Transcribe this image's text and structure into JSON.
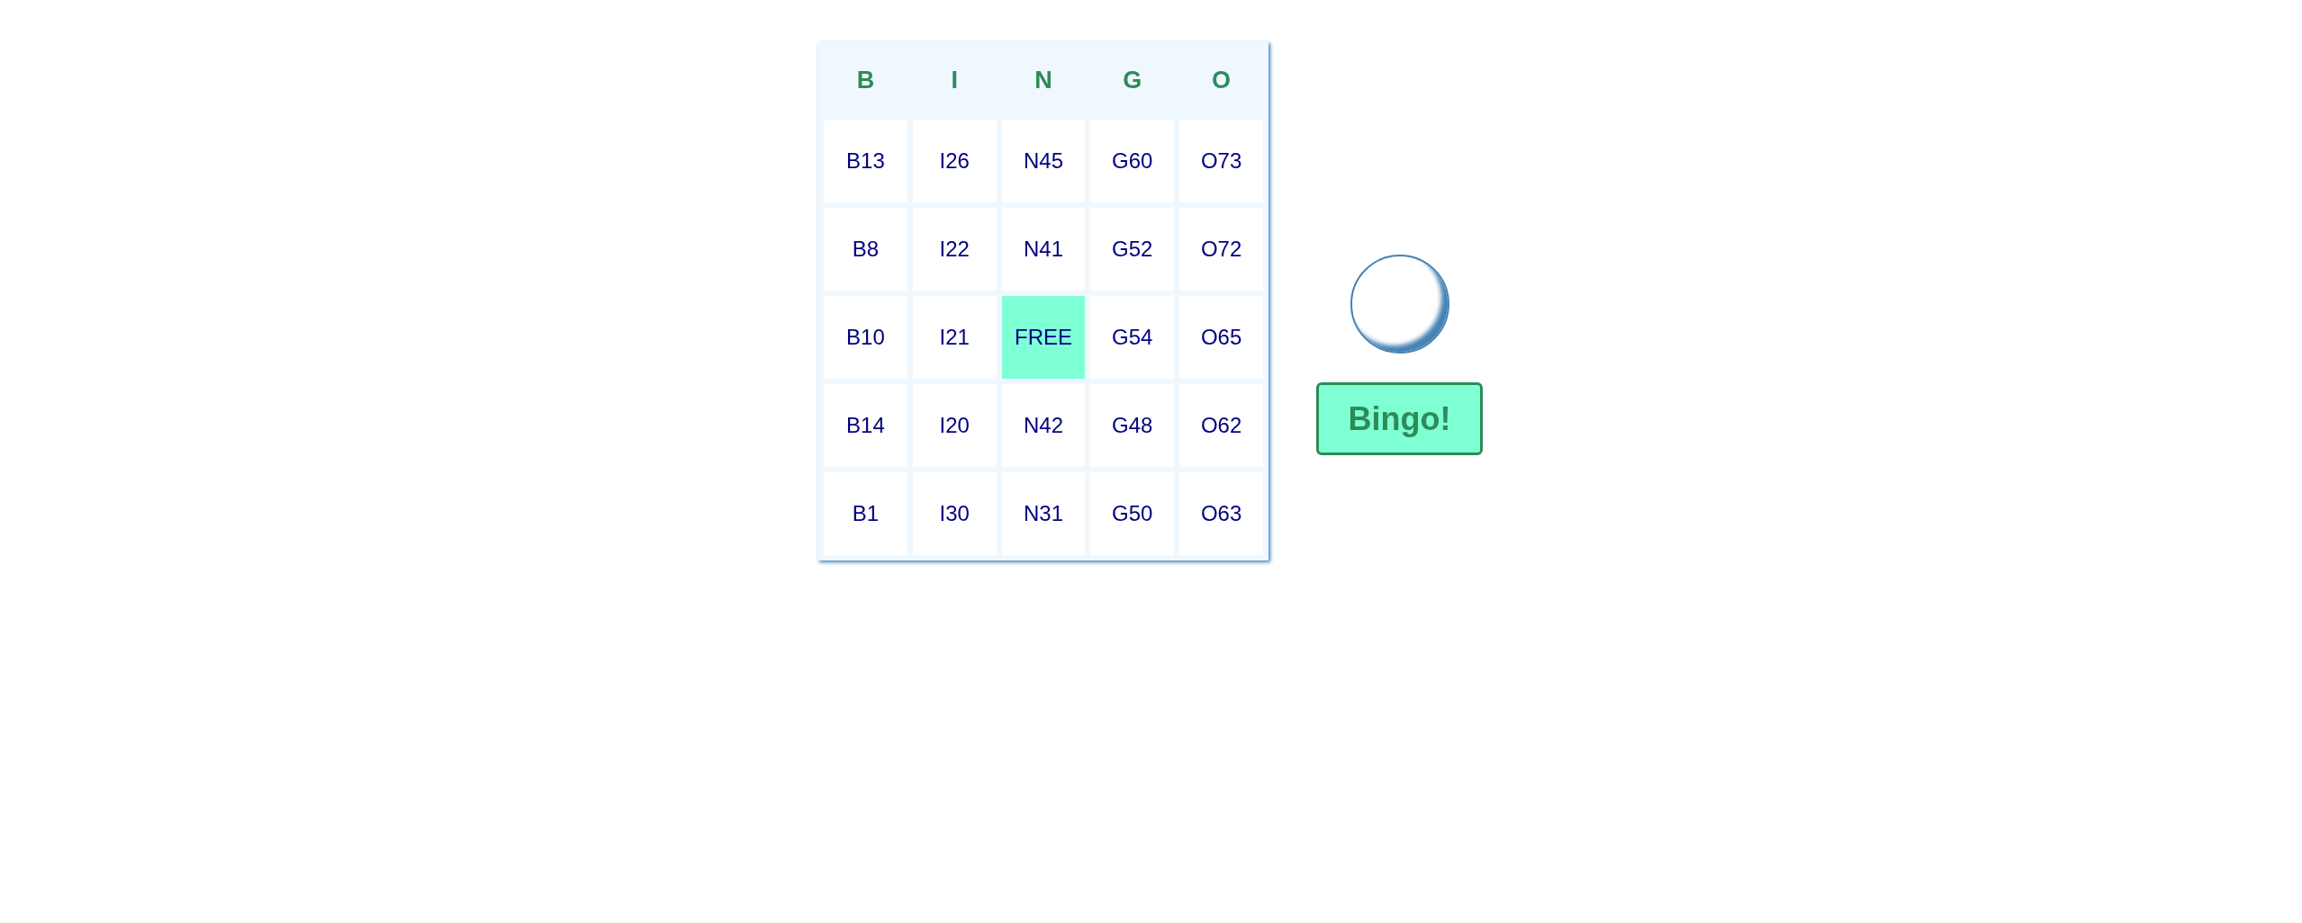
{
  "board": {
    "columns": [
      "B",
      "I",
      "N",
      "G",
      "O"
    ],
    "rows": [
      [
        {
          "label": "B13",
          "marked": false
        },
        {
          "label": "I26",
          "marked": false
        },
        {
          "label": "N45",
          "marked": false
        },
        {
          "label": "G60",
          "marked": false
        },
        {
          "label": "O73",
          "marked": false
        }
      ],
      [
        {
          "label": "B8",
          "marked": false
        },
        {
          "label": "I22",
          "marked": false
        },
        {
          "label": "N41",
          "marked": false
        },
        {
          "label": "G52",
          "marked": false
        },
        {
          "label": "O72",
          "marked": false
        }
      ],
      [
        {
          "label": "B10",
          "marked": false
        },
        {
          "label": "I21",
          "marked": false
        },
        {
          "label": "FREE",
          "marked": true
        },
        {
          "label": "G54",
          "marked": false
        },
        {
          "label": "O65",
          "marked": false
        }
      ],
      [
        {
          "label": "B14",
          "marked": false
        },
        {
          "label": "I20",
          "marked": false
        },
        {
          "label": "N42",
          "marked": false
        },
        {
          "label": "G48",
          "marked": false
        },
        {
          "label": "O62",
          "marked": false
        }
      ],
      [
        {
          "label": "B1",
          "marked": false
        },
        {
          "label": "I30",
          "marked": false
        },
        {
          "label": "N31",
          "marked": false
        },
        {
          "label": "G50",
          "marked": false
        },
        {
          "label": "O63",
          "marked": false
        }
      ]
    ]
  },
  "bingo_button": {
    "label": "Bingo!"
  }
}
